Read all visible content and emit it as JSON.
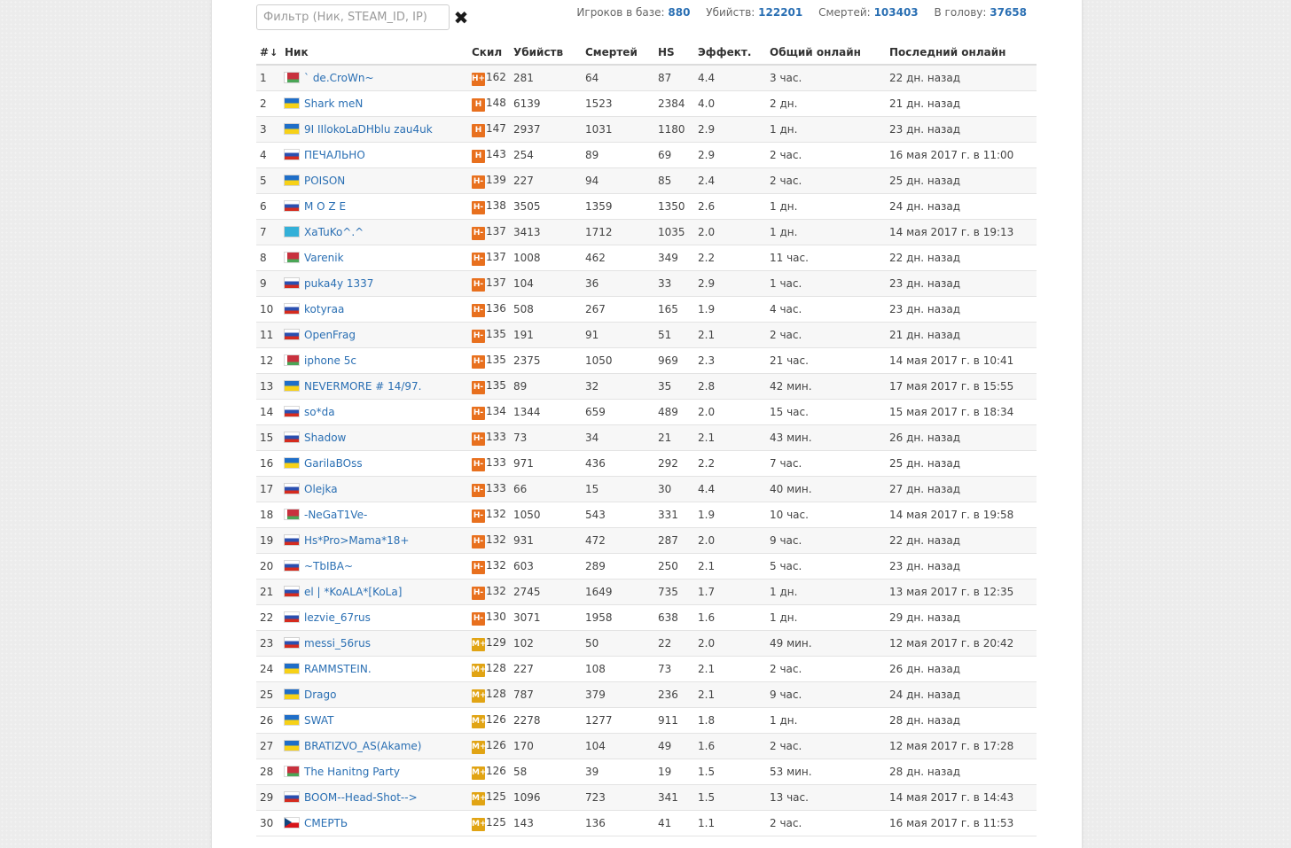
{
  "filter": {
    "placeholder": "Фильтр (Ник, STEAM_ID, IP)",
    "value": ""
  },
  "stats": {
    "players_label": "Игроков в базе:",
    "players": "880",
    "kills_label": "Убийств:",
    "kills": "122201",
    "deaths_label": "Смертей:",
    "deaths": "103403",
    "hs_label": "В голову:",
    "hs": "37658"
  },
  "columns": {
    "num": "#",
    "nick": "Ник",
    "skill": "Скил",
    "kills": "Убийств",
    "deaths": "Смертей",
    "hs": "HS",
    "eff": "Эффект.",
    "total_online": "Общий онлайн",
    "last_online": "Последний онлайн"
  },
  "sort_icon": "↓",
  "rows": [
    {
      "num": "1",
      "flag": "by",
      "nick": "` de.CroWn~",
      "badge": "H+",
      "skill": "162",
      "kills": "281",
      "deaths": "64",
      "hs": "87",
      "eff": "4.4",
      "total": "3 час.",
      "last": "22 дн. назад"
    },
    {
      "num": "2",
      "flag": "ua",
      "nick": "Shark meN",
      "badge": "H",
      "skill": "148",
      "kills": "6139",
      "deaths": "1523",
      "hs": "2384",
      "eff": "4.0",
      "total": "2 дн.",
      "last": "21 дн. назад"
    },
    {
      "num": "3",
      "flag": "ua",
      "nick": "9I IIlokoLaDHblu zau4uk",
      "badge": "H",
      "skill": "147",
      "kills": "2937",
      "deaths": "1031",
      "hs": "1180",
      "eff": "2.9",
      "total": "1 дн.",
      "last": "23 дн. назад"
    },
    {
      "num": "4",
      "flag": "ru",
      "nick": "ПЕЧАЛЬНО",
      "badge": "H",
      "skill": "143",
      "kills": "254",
      "deaths": "89",
      "hs": "69",
      "eff": "2.9",
      "total": "2 час.",
      "last": "16 мая 2017 г. в 11:00"
    },
    {
      "num": "5",
      "flag": "ua",
      "nick": "POISON",
      "badge": "H-",
      "skill": "139",
      "kills": "227",
      "deaths": "94",
      "hs": "85",
      "eff": "2.4",
      "total": "2 час.",
      "last": "25 дн. назад"
    },
    {
      "num": "6",
      "flag": "ru",
      "nick": "M O Z E",
      "badge": "H-",
      "skill": "138",
      "kills": "3505",
      "deaths": "1359",
      "hs": "1350",
      "eff": "2.6",
      "total": "1 дн.",
      "last": "24 дн. назад"
    },
    {
      "num": "7",
      "flag": "kz",
      "nick": "XaTuKo^.^",
      "badge": "H-",
      "skill": "137",
      "kills": "3413",
      "deaths": "1712",
      "hs": "1035",
      "eff": "2.0",
      "total": "1 дн.",
      "last": "14 мая 2017 г. в 19:13"
    },
    {
      "num": "8",
      "flag": "by",
      "nick": "Varenik",
      "badge": "H-",
      "skill": "137",
      "kills": "1008",
      "deaths": "462",
      "hs": "349",
      "eff": "2.2",
      "total": "11 час.",
      "last": "22 дн. назад"
    },
    {
      "num": "9",
      "flag": "ru",
      "nick": "puka4y 1337",
      "badge": "H-",
      "skill": "137",
      "kills": "104",
      "deaths": "36",
      "hs": "33",
      "eff": "2.9",
      "total": "1 час.",
      "last": "23 дн. назад"
    },
    {
      "num": "10",
      "flag": "ru",
      "nick": "kotyraa",
      "badge": "H-",
      "skill": "136",
      "kills": "508",
      "deaths": "267",
      "hs": "165",
      "eff": "1.9",
      "total": "4 час.",
      "last": "23 дн. назад"
    },
    {
      "num": "11",
      "flag": "ru",
      "nick": "OpenFrag",
      "badge": "H-",
      "skill": "135",
      "kills": "191",
      "deaths": "91",
      "hs": "51",
      "eff": "2.1",
      "total": "2 час.",
      "last": "21 дн. назад"
    },
    {
      "num": "12",
      "flag": "by",
      "nick": "iphone 5c",
      "badge": "H-",
      "skill": "135",
      "kills": "2375",
      "deaths": "1050",
      "hs": "969",
      "eff": "2.3",
      "total": "21 час.",
      "last": "14 мая 2017 г. в 10:41"
    },
    {
      "num": "13",
      "flag": "ua",
      "nick": "NEVERMORE # 14/97.",
      "badge": "H-",
      "skill": "135",
      "kills": "89",
      "deaths": "32",
      "hs": "35",
      "eff": "2.8",
      "total": "42 мин.",
      "last": "17 мая 2017 г. в 15:55"
    },
    {
      "num": "14",
      "flag": "ru",
      "nick": "so*da",
      "badge": "H-",
      "skill": "134",
      "kills": "1344",
      "deaths": "659",
      "hs": "489",
      "eff": "2.0",
      "total": "15 час.",
      "last": "15 мая 2017 г. в 18:34"
    },
    {
      "num": "15",
      "flag": "ru",
      "nick": "Shadow",
      "badge": "H-",
      "skill": "133",
      "kills": "73",
      "deaths": "34",
      "hs": "21",
      "eff": "2.1",
      "total": "43 мин.",
      "last": "26 дн. назад"
    },
    {
      "num": "16",
      "flag": "ua",
      "nick": "GarilaBOss",
      "badge": "H-",
      "skill": "133",
      "kills": "971",
      "deaths": "436",
      "hs": "292",
      "eff": "2.2",
      "total": "7 час.",
      "last": "25 дн. назад"
    },
    {
      "num": "17",
      "flag": "ru",
      "nick": "Olejka",
      "badge": "H-",
      "skill": "133",
      "kills": "66",
      "deaths": "15",
      "hs": "30",
      "eff": "4.4",
      "total": "40 мин.",
      "last": "27 дн. назад"
    },
    {
      "num": "18",
      "flag": "by",
      "nick": "-NeGaT1Ve-",
      "badge": "H-",
      "skill": "132",
      "kills": "1050",
      "deaths": "543",
      "hs": "331",
      "eff": "1.9",
      "total": "10 час.",
      "last": "14 мая 2017 г. в 19:58"
    },
    {
      "num": "19",
      "flag": "ru",
      "nick": "Hs*Pro>Mama*18+",
      "badge": "H-",
      "skill": "132",
      "kills": "931",
      "deaths": "472",
      "hs": "287",
      "eff": "2.0",
      "total": "9 час.",
      "last": "22 дн. назад"
    },
    {
      "num": "20",
      "flag": "ru",
      "nick": "~TbIBA~",
      "badge": "H-",
      "skill": "132",
      "kills": "603",
      "deaths": "289",
      "hs": "250",
      "eff": "2.1",
      "total": "5 час.",
      "last": "23 дн. назад"
    },
    {
      "num": "21",
      "flag": "ru",
      "nick": "el | *KoALA*[KoLa]",
      "badge": "H-",
      "skill": "132",
      "kills": "2745",
      "deaths": "1649",
      "hs": "735",
      "eff": "1.7",
      "total": "1 дн.",
      "last": "13 мая 2017 г. в 12:35"
    },
    {
      "num": "22",
      "flag": "ru",
      "nick": "lezvie_67rus",
      "badge": "H-",
      "skill": "130",
      "kills": "3071",
      "deaths": "1958",
      "hs": "638",
      "eff": "1.6",
      "total": "1 дн.",
      "last": "29 дн. назад"
    },
    {
      "num": "23",
      "flag": "ru",
      "nick": "messi_56rus",
      "badge": "M+",
      "skill": "129",
      "kills": "102",
      "deaths": "50",
      "hs": "22",
      "eff": "2.0",
      "total": "49 мин.",
      "last": "12 мая 2017 г. в 20:42"
    },
    {
      "num": "24",
      "flag": "ua",
      "nick": "RAMMSTEIN.",
      "badge": "M+",
      "skill": "128",
      "kills": "227",
      "deaths": "108",
      "hs": "73",
      "eff": "2.1",
      "total": "2 час.",
      "last": "26 дн. назад"
    },
    {
      "num": "25",
      "flag": "ua",
      "nick": "Drago",
      "badge": "M+",
      "skill": "128",
      "kills": "787",
      "deaths": "379",
      "hs": "236",
      "eff": "2.1",
      "total": "9 час.",
      "last": "24 дн. назад"
    },
    {
      "num": "26",
      "flag": "ua",
      "nick": "SWAT",
      "badge": "M+",
      "skill": "126",
      "kills": "2278",
      "deaths": "1277",
      "hs": "911",
      "eff": "1.8",
      "total": "1 дн.",
      "last": "28 дн. назад"
    },
    {
      "num": "27",
      "flag": "ua",
      "nick": "BRATIZVO_AS(Akame)",
      "badge": "M+",
      "skill": "126",
      "kills": "170",
      "deaths": "104",
      "hs": "49",
      "eff": "1.6",
      "total": "2 час.",
      "last": "12 мая 2017 г. в 17:28"
    },
    {
      "num": "28",
      "flag": "by",
      "nick": "The Hanitng Party",
      "badge": "M+",
      "skill": "126",
      "kills": "58",
      "deaths": "39",
      "hs": "19",
      "eff": "1.5",
      "total": "53 мин.",
      "last": "28 дн. назад"
    },
    {
      "num": "29",
      "flag": "ru",
      "nick": "BOOM--Head-Shot-->",
      "badge": "M+",
      "skill": "125",
      "kills": "1096",
      "deaths": "723",
      "hs": "341",
      "eff": "1.5",
      "total": "13 час.",
      "last": "14 мая 2017 г. в 14:43"
    },
    {
      "num": "30",
      "flag": "cz",
      "nick": "СМЕРТЬ",
      "badge": "M+",
      "skill": "125",
      "kills": "143",
      "deaths": "136",
      "hs": "41",
      "eff": "1.1",
      "total": "2 час.",
      "last": "16 мая 2017 г. в 11:53"
    }
  ]
}
